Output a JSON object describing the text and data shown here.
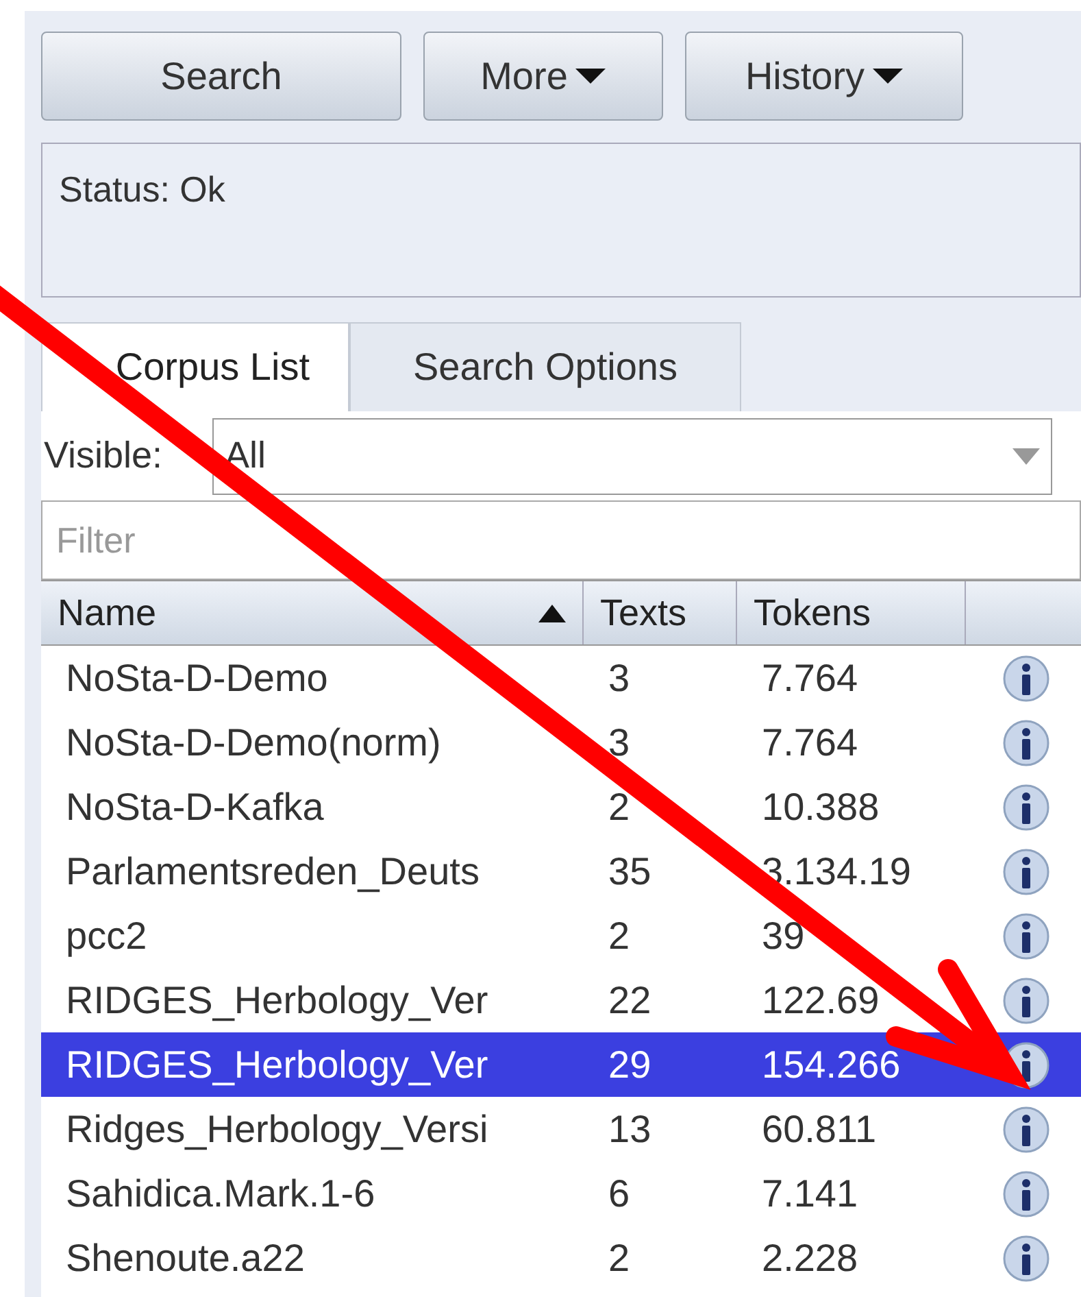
{
  "toolbar": [
    {
      "label": "Search",
      "dropdown": false
    },
    {
      "label": "More",
      "dropdown": true
    },
    {
      "label": "History",
      "dropdown": true
    }
  ],
  "status": "Status: Ok",
  "tabs": [
    {
      "label": "Corpus List",
      "selected": true
    },
    {
      "label": "Search Options",
      "selected": false
    }
  ],
  "visible": {
    "label": "Visible:",
    "value": "All"
  },
  "filter": {
    "placeholder": "Filter"
  },
  "table": {
    "columns": [
      {
        "label": "Name",
        "sorted": true
      },
      {
        "label": "Texts"
      },
      {
        "label": "Tokens"
      }
    ],
    "rows": [
      {
        "name": "NoSta-D-Demo",
        "texts": "3",
        "tokens": "7.764",
        "selected": false
      },
      {
        "name": "NoSta-D-Demo(norm)",
        "texts": "3",
        "tokens": "7.764",
        "selected": false
      },
      {
        "name": "NoSta-D-Kafka",
        "texts": "2",
        "tokens": "10.388",
        "selected": false
      },
      {
        "name": "Parlamentsreden_Deuts",
        "texts": "35",
        "tokens": "3.134.19",
        "selected": false
      },
      {
        "name": "pcc2",
        "texts": "2",
        "tokens": "39",
        "selected": false
      },
      {
        "name": "RIDGES_Herbology_Ver",
        "texts": "22",
        "tokens": "122.69",
        "selected": false
      },
      {
        "name": "RIDGES_Herbology_Ver",
        "texts": "29",
        "tokens": "154.266",
        "selected": true
      },
      {
        "name": "Ridges_Herbology_Versi",
        "texts": "13",
        "tokens": "60.811",
        "selected": false
      },
      {
        "name": "Sahidica.Mark.1-6",
        "texts": "6",
        "tokens": "7.141",
        "selected": false
      },
      {
        "name": "Shenoute.a22",
        "texts": "2",
        "tokens": "2.228",
        "selected": false
      }
    ]
  }
}
